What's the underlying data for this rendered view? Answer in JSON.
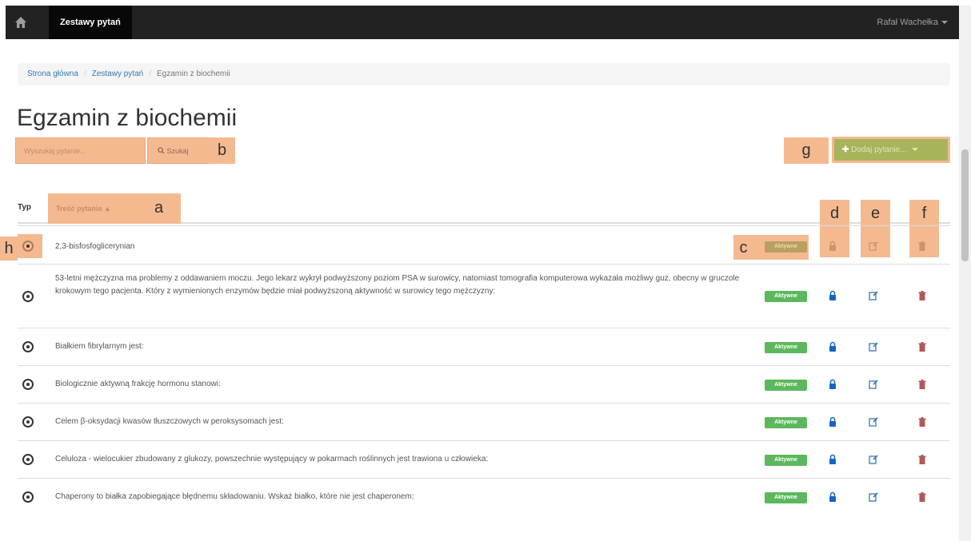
{
  "navbar": {
    "home_icon": "home-icon",
    "active_tab": "Zestawy pytań",
    "user_name": "Rafał Wachełka"
  },
  "breadcrumb": {
    "items": [
      "Strona główna",
      "Zestawy pytań",
      "Egzamin z biochemii"
    ]
  },
  "page": {
    "title": "Egzamin z biochemii"
  },
  "search": {
    "placeholder": "Wyszukaj pytanie...",
    "button_label": "Szukaj"
  },
  "add_question": {
    "label": "Dodaj pytanie..."
  },
  "table": {
    "headers": {
      "type": "Typ",
      "content": "Treść pytania ▲"
    },
    "rows": [
      {
        "text": "2,3-bisfosfoglicerynian",
        "status": "Aktywne"
      },
      {
        "text": "53-letni mężczyzna ma problemy z oddawaniem moczu. Jego lekarz wykrył podwyższony poziom PSA w surowicy, natomiast tomografia komputerowa wykazała możliwy guz, obecny w gruczole krokowym tego pacjenta. Który z wymienionych enzymów będzie miał podwyższoną aktywność w surowicy tego mężczyzny:",
        "status": "Aktywne"
      },
      {
        "text": "Białkiem fibrylarnym jest:",
        "status": "Aktywne"
      },
      {
        "text": "Biologicznie aktywną frakcję hormonu stanowi:",
        "status": "Aktywne"
      },
      {
        "text": "Celem β-oksydacji kwasów tłuszczowych w peroksysomach jest:",
        "status": "Aktywne"
      },
      {
        "text": "Celuloza - wielocukier zbudowany z glukozy, powszechnie występujący w pokarmach roślinnych jest trawiona u człowieka:",
        "status": "Aktywne"
      },
      {
        "text": "Chaperony to białka zapobiegające błędnemu składowaniu. Wskaż białko, które nie jest chaperonem:",
        "status": "Aktywne"
      }
    ]
  },
  "annotations": {
    "a": "a",
    "b": "b",
    "c": "c",
    "d": "d",
    "e": "e",
    "f": "f",
    "g": "g",
    "h": "h"
  },
  "colors": {
    "annotation": "#f5b990",
    "badge": "#5cb85c",
    "lock": "#1565c0",
    "edit": "#337ab7",
    "trash": "#b05a5a",
    "add_button": "#a8b45a"
  }
}
